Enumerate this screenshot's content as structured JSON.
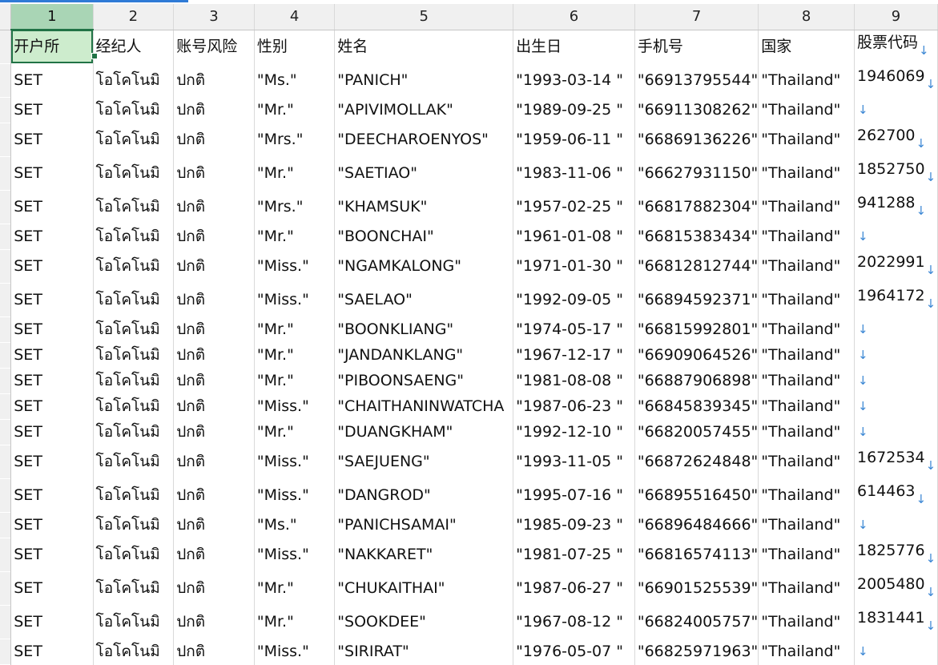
{
  "columns": [
    "1",
    "2",
    "3",
    "4",
    "5",
    "6",
    "7",
    "8",
    "9"
  ],
  "header_row": [
    "开户所",
    "经纪人",
    "账号风险",
    "性别",
    "姓名",
    "出生日",
    "手机号",
    "国家",
    "股票代码"
  ],
  "rows": [
    [
      "SET",
      "โอโคโนมิ",
      "ปกติ",
      "\"Ms.\"",
      "\"PANICH\"",
      "\"1993-03-14 \"",
      "\"66913795544\"",
      "\"Thailand\"",
      "1946069"
    ],
    [
      "SET",
      "โอโคโนมิ",
      "ปกติ",
      "\"Mr.\"",
      "\"APIVIMOLLAK\"",
      "\"1989-09-25 \"",
      "\"66911308262\"",
      "\"Thailand\"",
      ""
    ],
    [
      "SET",
      "โอโคโนมิ",
      "ปกติ",
      "\"Mrs.\"",
      "\"DEECHAROENYOS\"",
      "\"1959-06-11 \"",
      "\"66869136226\"",
      "\"Thailand\"",
      "262700"
    ],
    [
      "SET",
      "โอโคโนมิ",
      "ปกติ",
      "\"Mr.\"",
      "\"SAETIAO\"",
      "\"1983-11-06 \"",
      "\"66627931150\"",
      "\"Thailand\"",
      "1852750"
    ],
    [
      "SET",
      "โอโคโนมิ",
      "ปกติ",
      "\"Mrs.\"",
      "\"KHAMSUK\"",
      "\"1957-02-25 \"",
      "\"66817882304\"",
      "\"Thailand\"",
      "941288"
    ],
    [
      "SET",
      "โอโคโนมิ",
      "ปกติ",
      "\"Mr.\"",
      "\"BOONCHAI\"",
      "\"1961-01-08 \"",
      "\"66815383434\"",
      "\"Thailand\"",
      ""
    ],
    [
      "SET",
      "โอโคโนมิ",
      "ปกติ",
      "\"Miss.\"",
      "\"NGAMKALONG\"",
      "\"1971-01-30 \"",
      "\"66812812744\"",
      "\"Thailand\"",
      "2022991"
    ],
    [
      "SET",
      "โอโคโนมิ",
      "ปกติ",
      "\"Miss.\"",
      "\"SAELAO\"",
      "\"1992-09-05 \"",
      "\"66894592371\"",
      "\"Thailand\"",
      "1964172"
    ],
    [
      "SET",
      "โอโคโนมิ",
      "ปกติ",
      "\"Mr.\"",
      "\"BOONKLIANG\"",
      "\"1974-05-17 \"",
      "\"66815992801\"",
      "\"Thailand\"",
      ""
    ],
    [
      "SET",
      "โอโคโนมิ",
      "ปกติ",
      "\"Mr.\"",
      "\"JANDANKLANG\"",
      "\"1967-12-17 \"",
      "\"66909064526\"",
      "\"Thailand\"",
      ""
    ],
    [
      "SET",
      "โอโคโนมิ",
      "ปกติ",
      "\"Mr.\"",
      "\"PIBOONSAENG\"",
      "\"1981-08-08 \"",
      "\"66887906898\"",
      "\"Thailand\"",
      ""
    ],
    [
      "SET",
      "โอโคโนมิ",
      "ปกติ",
      "\"Miss.\"",
      "\"CHAITHANINWATCHA",
      "\"1987-06-23 \"",
      "\"66845839345\"",
      "\"Thailand\"",
      ""
    ],
    [
      "SET",
      "โอโคโนมิ",
      "ปกติ",
      "\"Mr.\"",
      "\"DUANGKHAM\"",
      "\"1992-12-10 \"",
      "\"66820057455\"",
      "\"Thailand\"",
      ""
    ],
    [
      "SET",
      "โอโคโนมิ",
      "ปกติ",
      "\"Miss.\"",
      "\"SAEJUENG\"",
      "\"1993-11-05 \"",
      "\"66872624848\"",
      "\"Thailand\"",
      "1672534"
    ],
    [
      "SET",
      "โอโคโนมิ",
      "ปกติ",
      "\"Miss.\"",
      "\"DANGROD\"",
      "\"1995-07-16 \"",
      "\"66895516450\"",
      "\"Thailand\"",
      "614463"
    ],
    [
      "SET",
      "โอโคโนมิ",
      "ปกติ",
      "\"Ms.\"",
      "\"PANICHSAMAI\"",
      "\"1985-09-23 \"",
      "\"66896484666\"",
      "\"Thailand\"",
      ""
    ],
    [
      "SET",
      "โอโคโนมิ",
      "ปกติ",
      "\"Miss.\"",
      "\"NAKKARET\"",
      "\"1981-07-25 \"",
      "\"66816574113\"",
      "\"Thailand\"",
      "1825776"
    ],
    [
      "SET",
      "โอโคโนมิ",
      "ปกติ",
      "\"Mr.\"",
      "\"CHUKAITHAI\"",
      "\"1987-06-27 \"",
      "\"66901525539\"",
      "\"Thailand\"",
      "2005480"
    ],
    [
      "SET",
      "โอโคโนมิ",
      "ปกติ",
      "\"Mr.\"",
      "\"SOOKDEE\"",
      "\"1967-08-12 \"",
      "\"66824005757\"",
      "\"Thailand\"",
      "1831441"
    ],
    [
      "SET",
      "โอโคโนมิ",
      "ปกติ",
      "\"Miss.\"",
      "\"SIRIRAT\"",
      "\"1976-05-07 \"",
      "\"66825971963\"",
      "\"Thailand\"",
      ""
    ]
  ],
  "line_break_icon": "down-arrow-icon",
  "line_break_glyph": "↓",
  "colors": {
    "active_header": "#a9d5b5",
    "selected_cell": "#cdeccd",
    "selection_border": "#217346",
    "arrow": "#3a86d4"
  }
}
